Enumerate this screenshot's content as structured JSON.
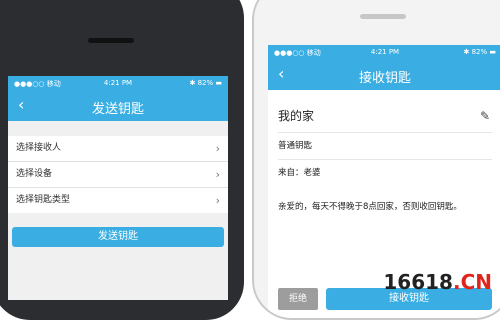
{
  "colors": {
    "accent": "#3aaee3",
    "reject": "#9d9d9d",
    "watermark_accent": "#e0241b"
  },
  "left_phone": {
    "status": {
      "carrier": "●●●○○ 移动 ",
      "time": "4:21 PM",
      "battery": "✱ 82% ▬"
    },
    "nav": {
      "back_icon": "chevron-left-icon",
      "back_glyph": "‹",
      "title": "发送钥匙"
    },
    "items": [
      {
        "label": "选择接收人",
        "chevron": "›"
      },
      {
        "label": "选择设备",
        "chevron": "›"
      },
      {
        "label": "选择钥匙类型",
        "chevron": "›"
      }
    ],
    "send_button": "发送钥匙"
  },
  "right_phone": {
    "status": {
      "carrier": "●●●○○ 移动 ",
      "time": "4:21 PM",
      "battery": "✱ 82% ▬"
    },
    "nav": {
      "back_icon": "chevron-left-icon",
      "back_glyph": "‹",
      "title": "接收钥匙"
    },
    "key_name": "我的家",
    "edit_icon": "pencil-icon",
    "edit_glyph": "✎",
    "key_type": "普通钥匙",
    "from": "来自：老婆",
    "message": "亲爱的，每天不得晚于8点回家，否则收回钥匙。",
    "reject_button": "拒绝",
    "receive_button": "接收钥匙"
  },
  "watermark": {
    "main": "16618",
    "suffix": ".CN"
  }
}
